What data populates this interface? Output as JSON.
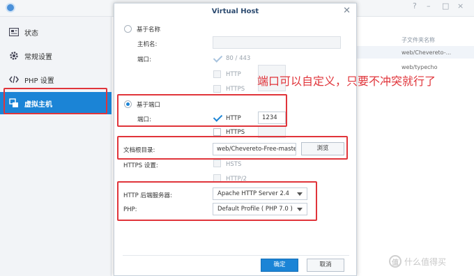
{
  "app": {
    "window_controls": [
      "?",
      "–",
      "□",
      "×"
    ],
    "sidebar": {
      "items": [
        {
          "label": "状态",
          "icon": "status-icon"
        },
        {
          "label": "常规设置",
          "icon": "gear-icon"
        },
        {
          "label": "PHP 设置",
          "icon": "code-icon"
        },
        {
          "label": "虚拟主机",
          "icon": "virtual-host-icon",
          "active": true
        }
      ]
    },
    "content": {
      "column_header": "子文件夹名称",
      "rows": [
        "web/Chevereto-...",
        "web/typecho"
      ]
    },
    "watermark": "什么值得买",
    "watermark_icon": "值"
  },
  "dialog": {
    "title": "Virtual Host",
    "by_name": {
      "radio_label": "基于名称",
      "hostname_label": "主机名:",
      "hostname_value": "",
      "port_label": "端口:",
      "port_option_80_443": "80 / 443",
      "port_option_http": "HTTP",
      "port_option_https": "HTTPS"
    },
    "by_port": {
      "radio_label": "基于端口",
      "port_label": "端口:",
      "http_label": "HTTP",
      "http_port": "1234",
      "https_label": "HTTPS"
    },
    "docroot": {
      "label": "文档根目录:",
      "value": "web/Chevereto-Free-maste",
      "browse_button": "浏览"
    },
    "https_settings": {
      "label": "HTTPS 设置:",
      "hsts": "HSTS",
      "http2": "HTTP/2"
    },
    "backend": {
      "label": "HTTP 后端服务器:",
      "value": "Apache HTTP Server 2.4"
    },
    "php": {
      "label": "PHP:",
      "value": "Default Profile ( PHP 7.0 )"
    },
    "ok_button": "确定",
    "cancel_button": "取消"
  },
  "annotation": "端口可以自定义，只要不冲突就行了",
  "colors": {
    "accent": "#1b84d6",
    "highlight_border": "#e0343a"
  }
}
